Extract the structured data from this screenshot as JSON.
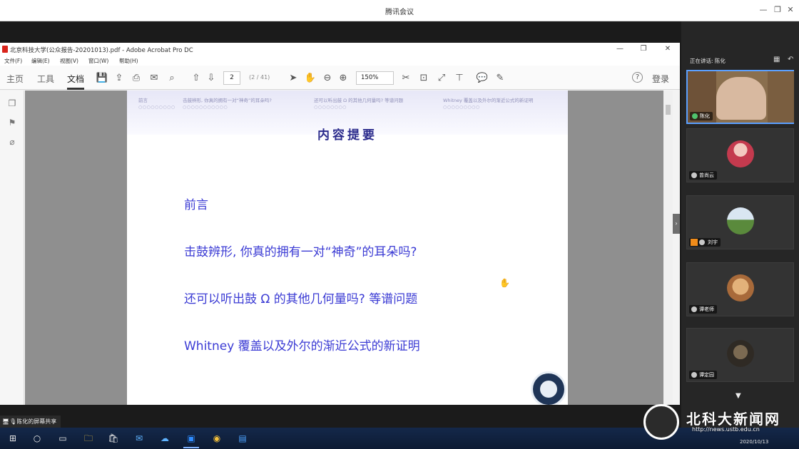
{
  "meeting": {
    "title": "腾讯会议",
    "minimize": "—",
    "restore": "❐",
    "close": "✕"
  },
  "acrobat": {
    "title": "北京科技大学(公众报告-20201013).pdf - Adobe Acrobat Pro DC",
    "minimize": "—",
    "restore": "❐",
    "close": "✕",
    "menu": [
      "文件(F)",
      "编辑(E)",
      "视图(V)",
      "窗口(W)",
      "帮助(H)"
    ],
    "tabs": [
      "主页",
      "工具",
      "文档"
    ],
    "page_current": "2",
    "page_total": "(2 / 41)",
    "zoom": "150%",
    "zoom_arrow": "▾",
    "login": "登录",
    "icons": {
      "save": "💾",
      "upload": "⇪",
      "print": "⎙",
      "mail": "✉",
      "search": "⌕",
      "prev_page": "⇧",
      "next_page": "⇩",
      "select": "➤",
      "hand": "✋",
      "zoom_out": "⊖",
      "zoom_in": "⊕",
      "crop": "✂",
      "fit": "⊡",
      "fullscreen": "⤢",
      "stamp": "⊤",
      "comment": "💬",
      "pen": "✎",
      "help": "?",
      "pages": "❐",
      "bookmark": "⚑",
      "attach": "⌀",
      "rail_arrow": "◂",
      "collapse": "›",
      "cursor": "✋"
    }
  },
  "slide": {
    "header_sections": [
      "前言",
      "击鼓辨形, 你真的拥有一对“神奇”的耳朵吗?",
      "还可以听出鼓 Ω 的其他几何量吗? 等谱问题",
      "Whitney 覆盖以及外尔的渐近公式的新证明"
    ],
    "header_dots": [
      "○○○○○○○○○",
      "○○○○○○○○○○○",
      "○○○○○○○○",
      "○○○○○○○○○"
    ],
    "title": "内容提要",
    "bullets": [
      "前言",
      "击鼓辨形, 你真的拥有一对“神奇”的耳朵吗?",
      "还可以听出鼓 Ω 的其他几何量吗? 等谱问题",
      "Whitney 覆盖以及外尔的渐近公式的新证明"
    ]
  },
  "panel": {
    "speaking_label": "正在讲话: 陈化",
    "icons": {
      "grid": "▦",
      "back": "↶",
      "mic": "🎙",
      "more": "▼"
    },
    "participants": [
      "陈化",
      "曾尚云",
      "刘宇",
      "谭老师",
      "谭定园"
    ]
  },
  "share_banner": "🖥🎙陈化的屏幕共享",
  "taskbar": {
    "icons": [
      "⊞",
      "○",
      "▭",
      "🗀",
      "🛍",
      "✉",
      "☁",
      "▣",
      "◉",
      "▤"
    ],
    "clock": "2020/10/13"
  },
  "watermark": {
    "title": "北科大新闻网",
    "url": "http://news.ustb.edu.cn"
  }
}
